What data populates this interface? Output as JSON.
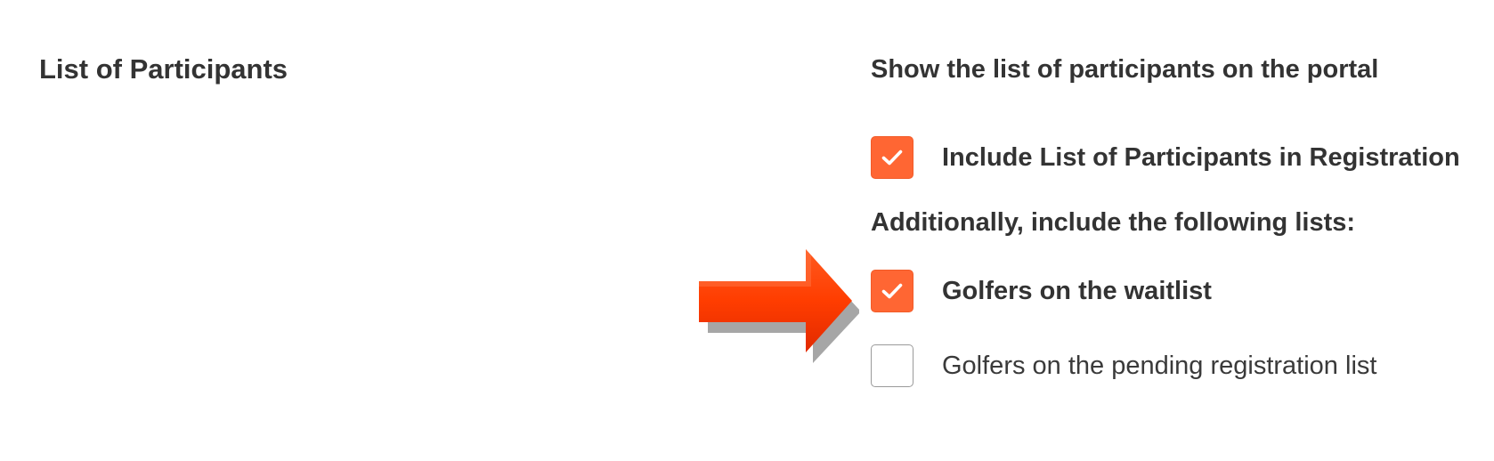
{
  "section": {
    "title": "List of Participants"
  },
  "settings": {
    "heading": "Show the list of participants on the portal",
    "include_option": {
      "label": "Include List of Participants in Registration",
      "checked": true
    },
    "additional_heading": "Additionally, include the following lists:",
    "lists": [
      {
        "label": "Golfers on the waitlist",
        "checked": true
      },
      {
        "label": "Golfers on the pending registration list",
        "checked": false
      }
    ]
  },
  "colors": {
    "checkbox_checked": "#ff6633",
    "arrow": "#ff3d00",
    "text": "#333333"
  },
  "icons": {
    "checkmark": "checkmark-icon",
    "pointer": "arrow-right-icon"
  }
}
